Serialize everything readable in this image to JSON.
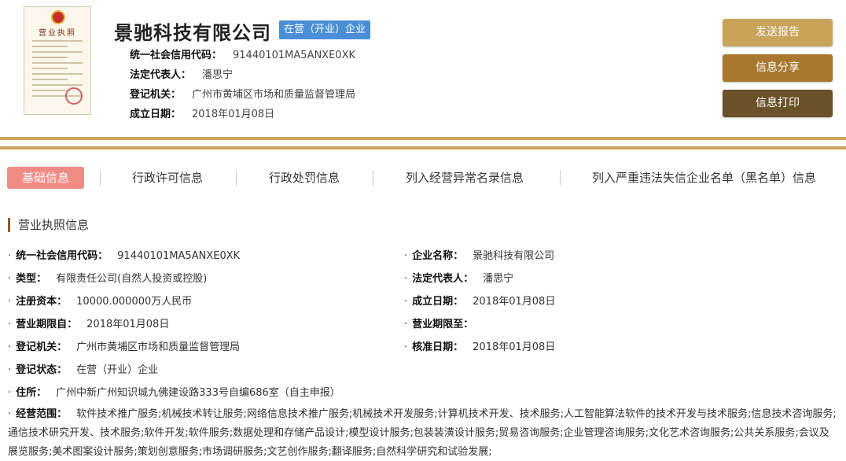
{
  "header": {
    "company_name": "景驰科技有限公司",
    "status": "在营（开业）企业",
    "license_thumb_title": "营业执照",
    "meta": [
      {
        "label": "统一社会信用代码：",
        "value": "91440101MA5ANXE0XK"
      },
      {
        "label": "法定代表人：",
        "value": "潘思宁"
      },
      {
        "label": "登记机关：",
        "value": "广州市黄埔区市场和质量监督管理局"
      },
      {
        "label": "成立日期：",
        "value": "2018年01月08日"
      }
    ]
  },
  "actions": {
    "send_report": "发送报告",
    "share": "信息分享",
    "print": "信息打印"
  },
  "colors": {
    "gold": "#c9a35a",
    "brown": "#a8782f",
    "dark_brown": "#6b5128",
    "status_blue": "#4a8fd6",
    "tab_active": "#f08b84"
  },
  "tabs": [
    {
      "label": "基础信息",
      "active": true
    },
    {
      "label": "行政许可信息"
    },
    {
      "label": "行政处罚信息"
    },
    {
      "label": "列入经营异常名录信息"
    },
    {
      "label": "列入严重违法失信企业名单（黑名单）信息"
    }
  ],
  "section": {
    "title": "营业执照信息",
    "bullet": "·",
    "left": [
      {
        "label": "统一社会信用代码：",
        "value": "91440101MA5ANXE0XK"
      },
      {
        "label": "类型：",
        "value": "有限责任公司(自然人投资或控股)"
      },
      {
        "label": "注册资本：",
        "value": "10000.000000万人民币"
      },
      {
        "label": "营业期限自：",
        "value": "2018年01月08日"
      },
      {
        "label": "登记机关：",
        "value": "广州市黄埔区市场和质量监督管理局"
      },
      {
        "label": "登记状态：",
        "value": "在营（开业）企业"
      },
      {
        "label": "住所：",
        "value": "广州中新广州知识城九佛建设路333号自编686室（自主申报）"
      }
    ],
    "right": [
      {
        "label": "企业名称：",
        "value": "景驰科技有限公司"
      },
      {
        "label": "法定代表人：",
        "value": "潘思宁"
      },
      {
        "label": "成立日期：",
        "value": "2018年01月08日"
      },
      {
        "label": "营业期限至：",
        "value": ""
      },
      {
        "label": "核准日期：",
        "value": "2018年01月08日"
      }
    ],
    "scope_label": "经营范围：",
    "scope_value": "软件技术推广服务;机械技术转让服务;网络信息技术推广服务;机械技术开发服务;计算机技术开发、技术服务;人工智能算法软件的技术开发与技术服务;信息技术咨询服务;通信技术研究开发、技术服务;软件开发;软件服务;数据处理和存储产品设计;模型设计服务;包装装潢设计服务;贸易咨询服务;企业管理咨询服务;文化艺术咨询服务;公共关系服务;会议及展览服务;美术图案设计服务;策划创意服务;市场调研服务;文艺创作服务;翻译服务;自然科学研究和试验发展;"
  }
}
